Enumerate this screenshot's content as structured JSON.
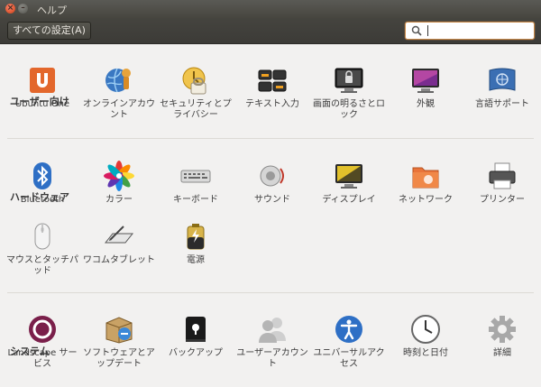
{
  "window": {
    "title": "ヘルプ",
    "close_glyph": "×",
    "min_glyph": "–"
  },
  "toolbar": {
    "all_settings_label": "すべての設定(A)",
    "search_value": ""
  },
  "sections": {
    "personal": {
      "title": "ユーザー向け",
      "items": [
        {
          "label": "Ubuntu One",
          "icon": "ubuntu-one-icon"
        },
        {
          "label": "オンラインアカウント",
          "icon": "online-accounts-icon"
        },
        {
          "label": "セキュリティとプライバシー",
          "icon": "security-privacy-icon"
        },
        {
          "label": "テキスト入力",
          "icon": "text-entry-icon"
        },
        {
          "label": "画面の明るさとロック",
          "icon": "brightness-lock-icon"
        },
        {
          "label": "外観",
          "icon": "appearance-icon"
        },
        {
          "label": "言語サポート",
          "icon": "language-support-icon"
        }
      ]
    },
    "hardware": {
      "title": "ハードウェア",
      "items": [
        {
          "label": "Bluetooth",
          "icon": "bluetooth-icon"
        },
        {
          "label": "カラー",
          "icon": "color-icon"
        },
        {
          "label": "キーボード",
          "icon": "keyboard-icon"
        },
        {
          "label": "サウンド",
          "icon": "sound-icon"
        },
        {
          "label": "ディスプレイ",
          "icon": "display-icon"
        },
        {
          "label": "ネットワーク",
          "icon": "network-icon"
        },
        {
          "label": "プリンター",
          "icon": "printer-icon"
        },
        {
          "label": "マウスとタッチパッド",
          "icon": "mouse-touchpad-icon"
        },
        {
          "label": "ワコムタブレット",
          "icon": "wacom-tablet-icon"
        },
        {
          "label": "電源",
          "icon": "power-icon"
        }
      ]
    },
    "system": {
      "title": "システム",
      "items": [
        {
          "label": "Landscape サービス",
          "icon": "landscape-icon"
        },
        {
          "label": "ソフトウェアとアップデート",
          "icon": "software-updates-icon"
        },
        {
          "label": "バックアップ",
          "icon": "backup-icon"
        },
        {
          "label": "ユーザーアカウント",
          "icon": "user-accounts-icon"
        },
        {
          "label": "ユニバーサルアクセス",
          "icon": "universal-access-icon"
        },
        {
          "label": "時刻と日付",
          "icon": "time-date-icon"
        },
        {
          "label": "詳細",
          "icon": "details-icon"
        }
      ]
    }
  }
}
